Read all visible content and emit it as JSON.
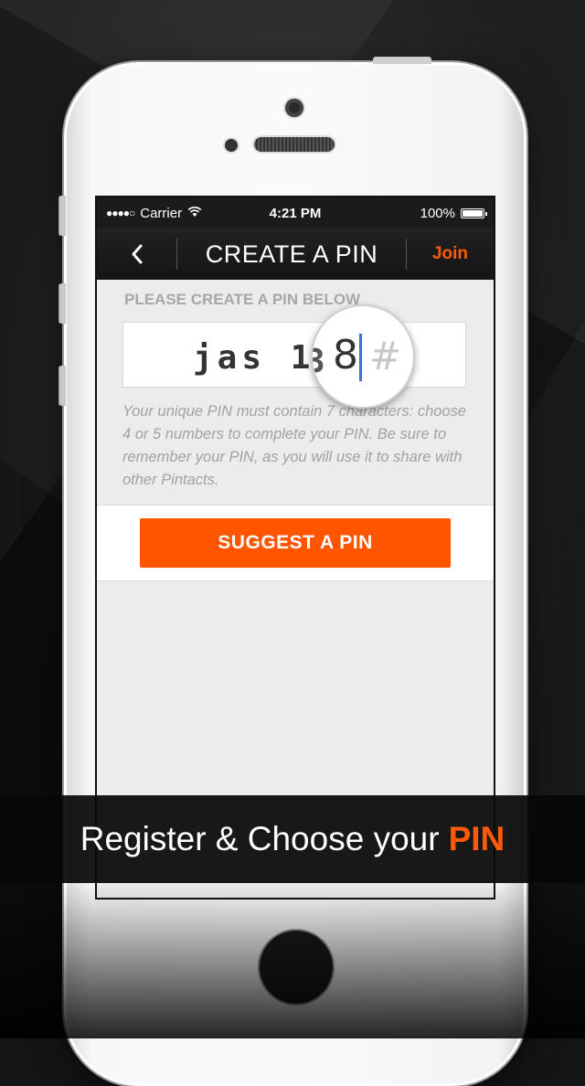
{
  "status_bar": {
    "signal": "●●●●○",
    "carrier": "Carrier",
    "time": "4:21 PM",
    "battery_pct": "100%"
  },
  "nav": {
    "back_glyph": "‹",
    "title": "CREATE A PIN",
    "join_label": "Join"
  },
  "form": {
    "section_label": "PLEASE CREATE A PIN BELOW",
    "pin_value": "jas 13",
    "magnified_char": "8",
    "magnified_hint": "#",
    "help_text": "Your unique PIN must contain 7 characters: choose 4 or 5 numbers to complete your PIN. Be sure to remember your PIN, as you will use it to share with other Pintacts."
  },
  "suggest_button": {
    "label": "SUGGEST A PIN"
  },
  "caption": {
    "prefix": "Register & Choose your",
    "highlight": "PIN"
  },
  "colors": {
    "accent": "#ff5500",
    "join": "#ff5a0a",
    "cursor": "#3a6fd8"
  }
}
